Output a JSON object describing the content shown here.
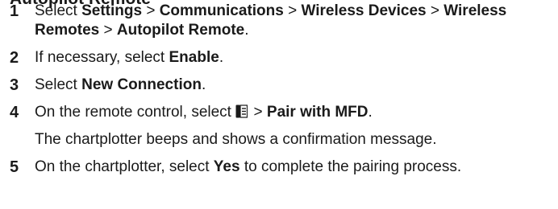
{
  "heading": "Autopilot Remote",
  "steps": [
    {
      "num": "1",
      "t0": "Select ",
      "b0": "Settings",
      "t1": " > ",
      "b1": "Communications",
      "t2": " > ",
      "b2": "Wireless Devices",
      "t3": " > ",
      "b3": "Wireless Remotes",
      "t4": " > ",
      "b4": "Autopilot Remote",
      "t5": "."
    },
    {
      "num": "2",
      "t0": "If necessary, select ",
      "b0": "Enable",
      "t1": "."
    },
    {
      "num": "3",
      "t0": "Select ",
      "b0": "New Connection",
      "t1": "."
    },
    {
      "num": "4",
      "t0": "On the remote control, select ",
      "icon": "menu-icon",
      "t1": " > ",
      "b0": "Pair with MFD",
      "t2": ".",
      "note": "The chartplotter beeps and shows a confirmation message."
    },
    {
      "num": "5",
      "t0": "On the chartplotter, select ",
      "b0": "Yes",
      "t1": " to complete the pairing process."
    }
  ]
}
